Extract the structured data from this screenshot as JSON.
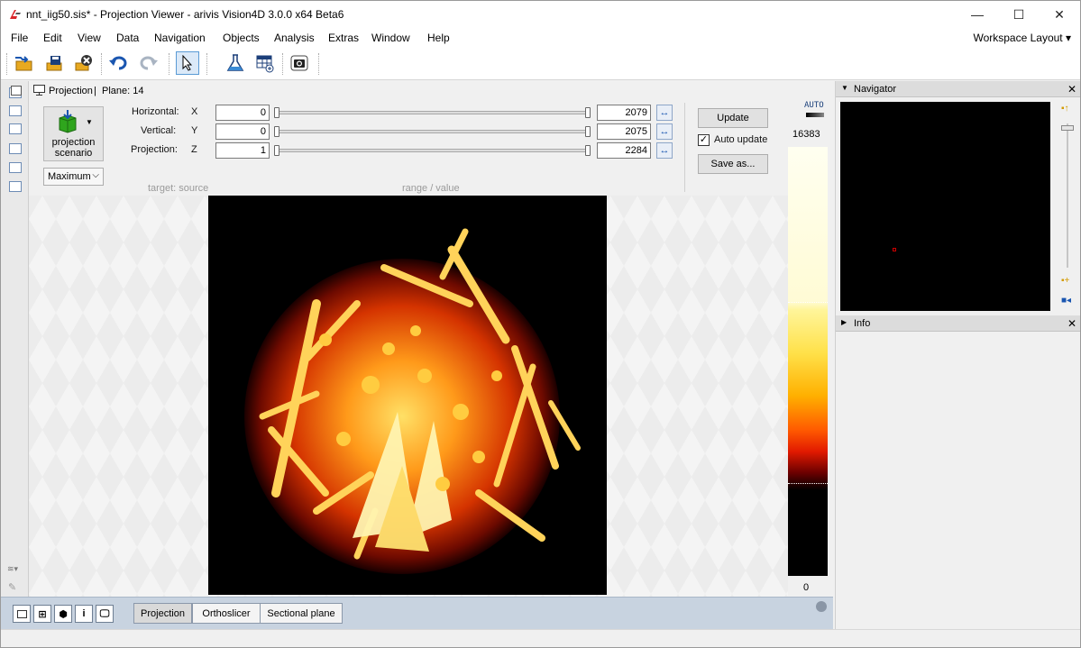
{
  "window": {
    "title": "nnt_iig50.sis* - Projection Viewer - arivis Vision4D 3.0.0 x64 Beta6",
    "minimize": "—",
    "maximize": "☐",
    "close": "✕"
  },
  "menu": {
    "items": [
      "File",
      "Edit",
      "View",
      "Data",
      "Navigation",
      "Objects",
      "Analysis",
      "Extras",
      "Window",
      "Help"
    ],
    "workspace_layout": "Workspace Layout ▾"
  },
  "viewer": {
    "header_label": "Projection",
    "header_sep": "|",
    "plane_label": "Plane: 14",
    "scenario_button": "projection\nscenario",
    "scenario_line1": "projection",
    "scenario_line2": "scenario",
    "mode_select": "Maximum",
    "rows": [
      {
        "label": "Horizontal:",
        "axis": "X",
        "min": "0",
        "max": "2079"
      },
      {
        "label": "Vertical:",
        "axis": "Y",
        "min": "0",
        "max": "2075"
      },
      {
        "label": "Projection:",
        "axis": "Z",
        "min": "1",
        "max": "2284"
      }
    ],
    "footer_target": "target:  source",
    "footer_range": "range / value",
    "update_button": "Update",
    "auto_update_label": "Auto update",
    "auto_update_checked": true,
    "save_as_button": "Save as...",
    "colorbar_auto": "AUTO",
    "colorbar_max": "16383",
    "colorbar_min": "0"
  },
  "bottom_tabs": {
    "info_icon": "i",
    "tabs": [
      "Projection",
      "Orthoslicer",
      "Sectional plane"
    ],
    "active": "Projection"
  },
  "panels": {
    "navigator": "Navigator",
    "info": "Info"
  },
  "colors": {
    "accent": "#1a56b0",
    "bottom_bar": "#c8d3e0"
  }
}
